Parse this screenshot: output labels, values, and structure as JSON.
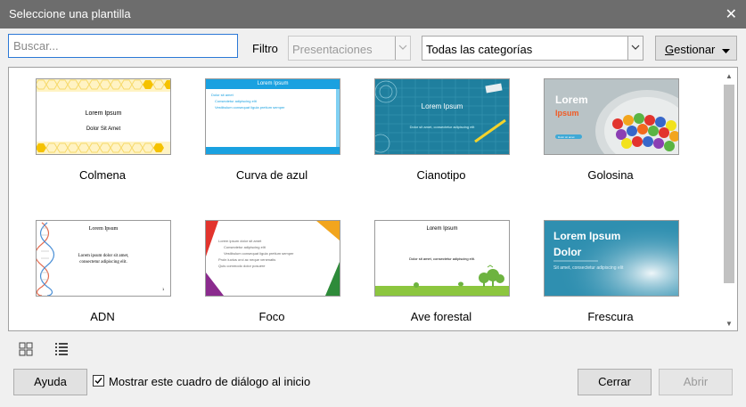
{
  "window": {
    "title": "Seleccione una plantilla",
    "close_symbol": "✕"
  },
  "toolbar": {
    "search_placeholder": "Buscar...",
    "filter_label": "Filtro",
    "filter_value": "Presentaciones",
    "category_value": "Todas las categorías",
    "manage_prefix": "G",
    "manage_rest": "estionar"
  },
  "templates": [
    {
      "name": "Colmena",
      "line1": "Lorem Ipsum",
      "line2": "Dolor Sit Amet"
    },
    {
      "name": "Curva de azul",
      "line1": "Lorem Ipsum",
      "line2": "Dolor sit amet",
      "line3": "Consectetur adipiscing elit",
      "line4": "Vestibulum consequat ligula pretium semper"
    },
    {
      "name": "Cianotipo",
      "line1": "Lorem Ipsum",
      "line2": "Dolor sit amet, consectetur adipiscing elit"
    },
    {
      "name": "Golosina",
      "line1": "Lorem",
      "line2": "Ipsum",
      "line3": "Dolor sit amet"
    },
    {
      "name": "ADN",
      "line1": "Lorem Ipsum",
      "line2": "Lorem ipsum dolor sit amet,",
      "line3": "consectetur adipiscing elit.",
      "page": "1"
    },
    {
      "name": "Foco",
      "line1": "Lorem ipsum dolor sit amet",
      "line2": "Consectetur adipiscing elit",
      "line3": "Vestibulum consequat ligula pretium semper",
      "line4": "Proin luctus orci ac neque venenatis",
      "line5": "Quis commodo dolor posuere"
    },
    {
      "name": "Ave forestal",
      "line1": "Lorem Ipsum",
      "line2": "Dolor sit amet, consectetur adipiscing elit."
    },
    {
      "name": "Frescura",
      "line1": "Lorem Ipsum",
      "line2": "Dolor",
      "line3": "Sit amet, consectetur adipiscing elit"
    }
  ],
  "footer": {
    "help_label": "Ayuda",
    "show_dialog_label": "Mostrar este cuadro de diálogo al inicio",
    "close_label": "Cerrar",
    "open_label": "Abrir"
  },
  "colors": {
    "titlebar": "#6d6d6d",
    "focus": "#2b78d6",
    "curva_blue": "#1aa1e0",
    "cianotipo_teal": "#1f7f9e",
    "frescura_blue": "#2f8fb0"
  }
}
